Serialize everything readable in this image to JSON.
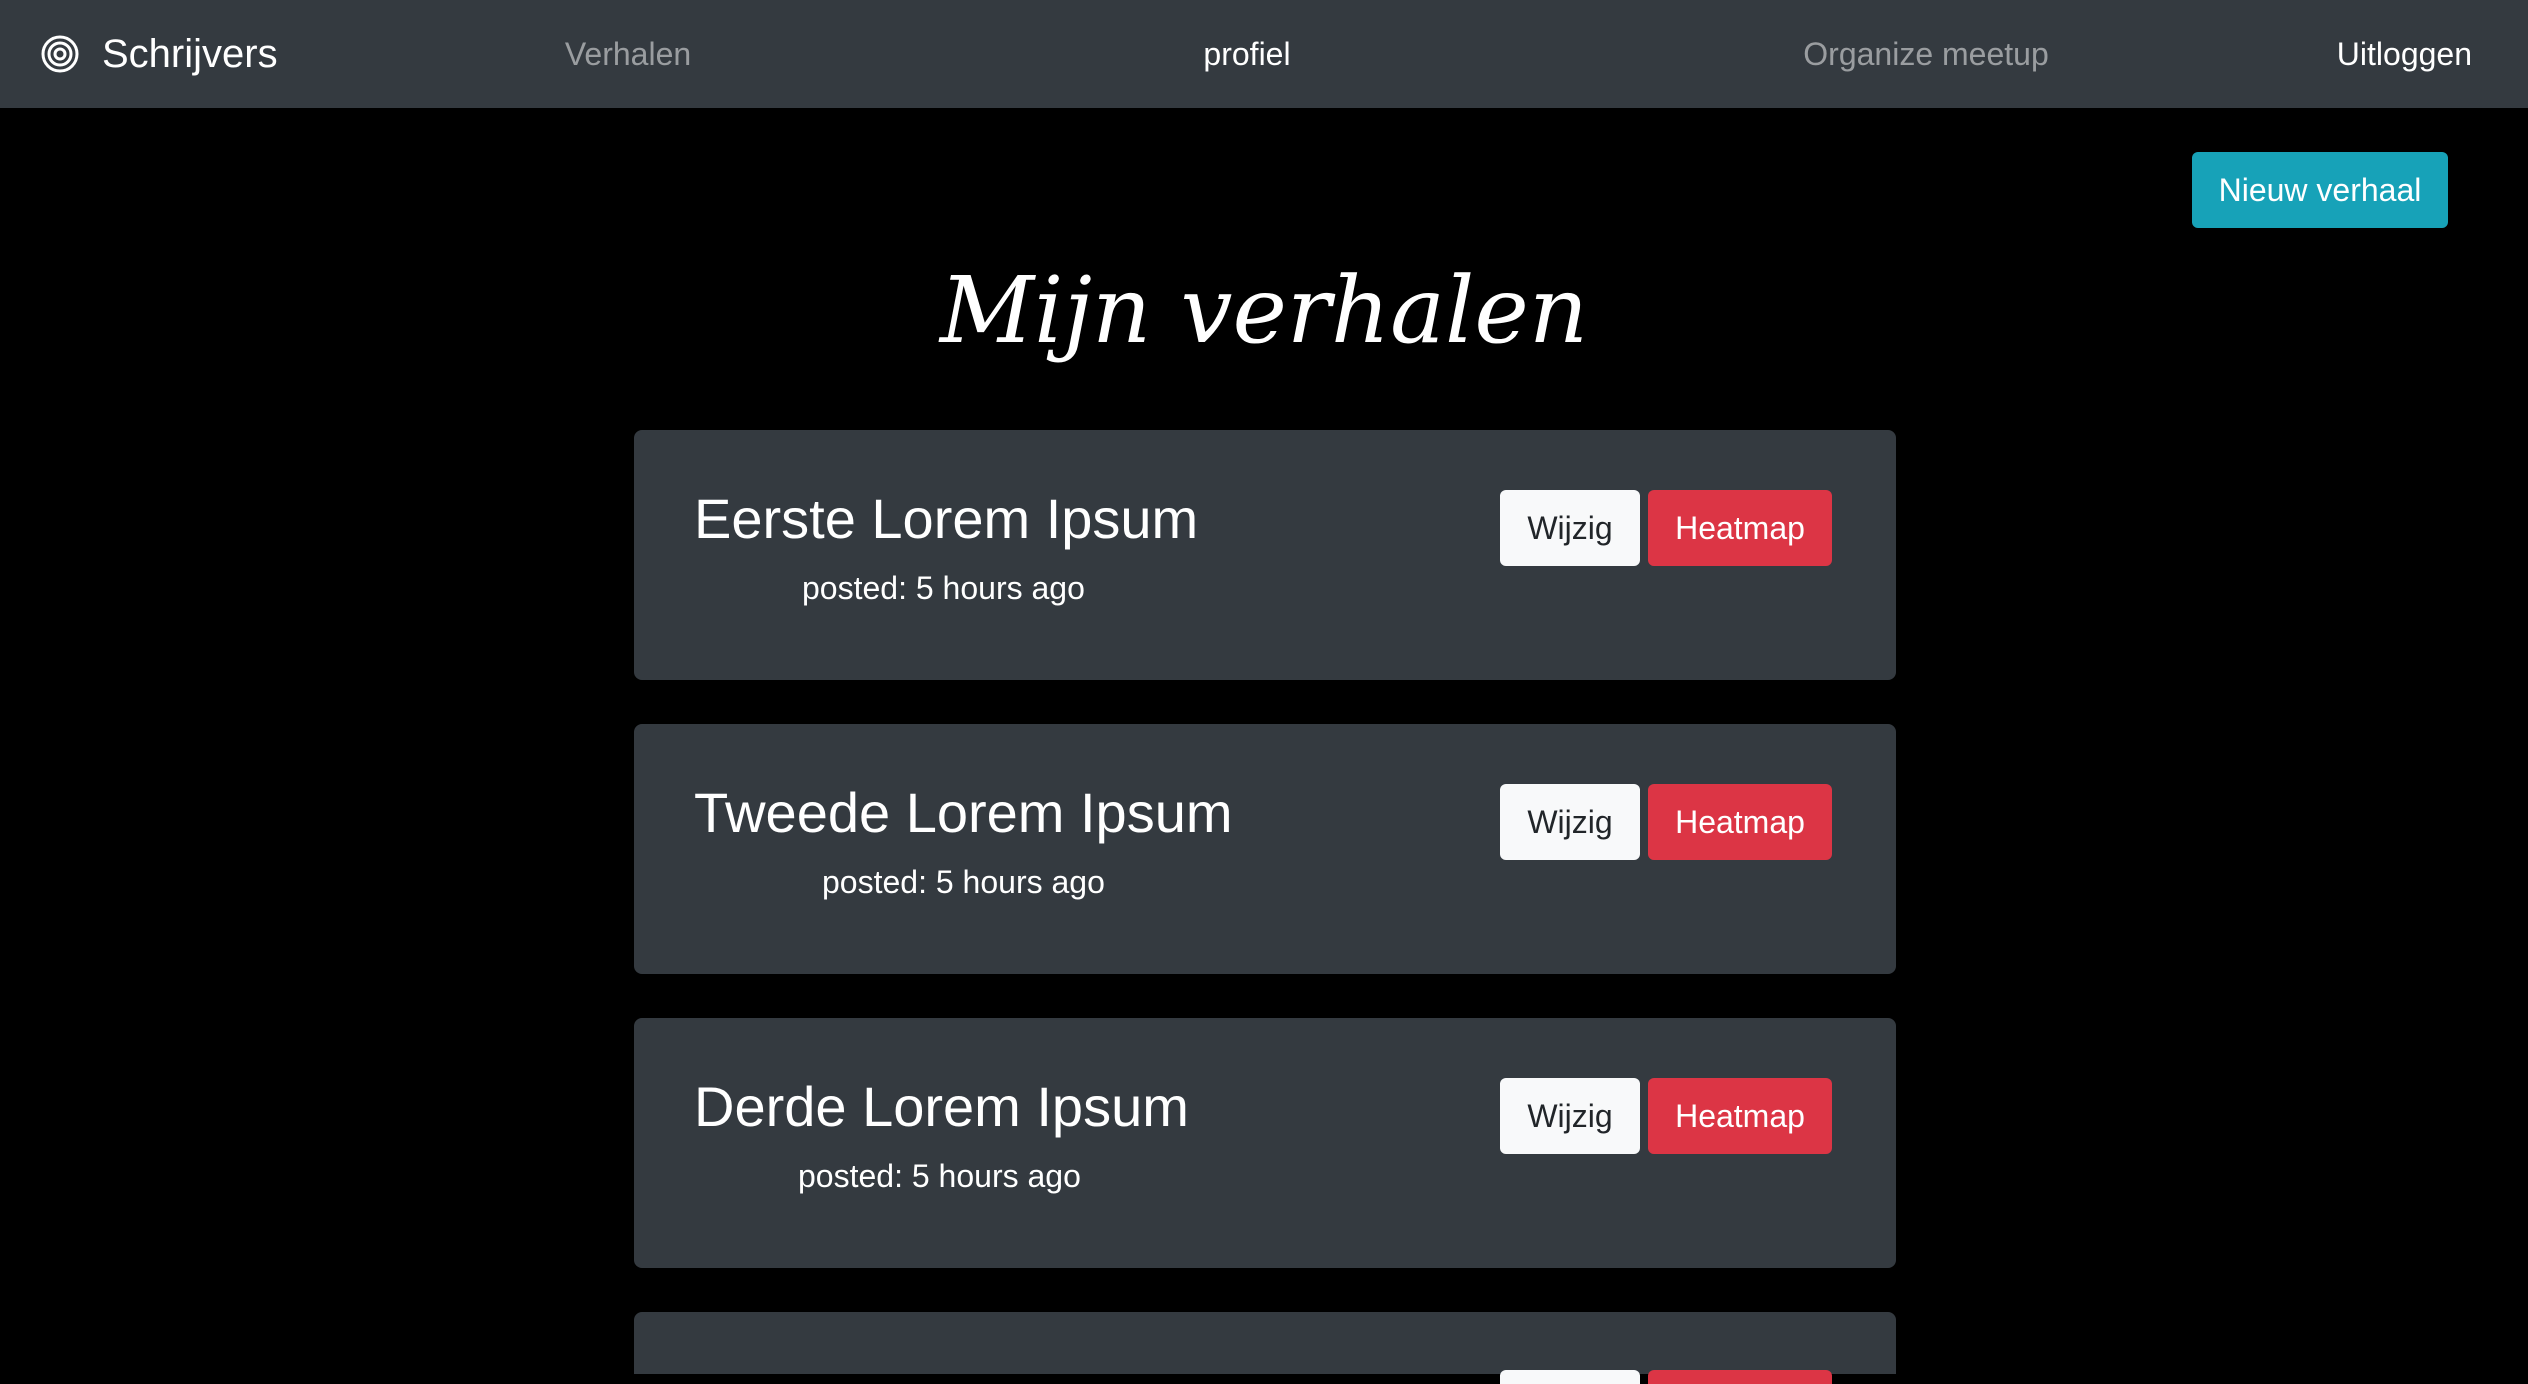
{
  "navbar": {
    "brand": "Schrijvers",
    "brand_icon": "concentric-circles-icon",
    "links": {
      "stories": "Verhalen",
      "profile": "profiel",
      "meetup": "Organize meetup"
    },
    "logout": "Uitloggen"
  },
  "actions": {
    "new_story": "Nieuw verhaal"
  },
  "page": {
    "title": "Mijn verhalen"
  },
  "stories": [
    {
      "title": "Eerste Lorem Ipsum",
      "meta": "posted: 5 hours ago",
      "edit_label": "Wijzig",
      "heatmap_label": "Heatmap"
    },
    {
      "title": "Tweede Lorem Ipsum",
      "meta": "posted: 5 hours ago",
      "edit_label": "Wijzig",
      "heatmap_label": "Heatmap"
    },
    {
      "title": "Derde Lorem Ipsum",
      "meta": "posted: 5 hours ago",
      "edit_label": "Wijzig",
      "heatmap_label": "Heatmap"
    }
  ],
  "colors": {
    "navbar_bg": "#343a40",
    "page_bg": "#000000",
    "card_bg": "#343a40",
    "info": "#17a2b8",
    "danger": "#dc3545",
    "light": "#f8f9fa"
  }
}
